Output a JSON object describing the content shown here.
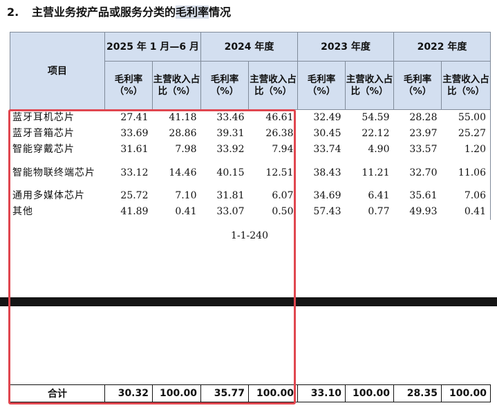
{
  "heading": {
    "number": "2.",
    "title_plain": "主营业务按产品或服务分类的",
    "title_highlight": "毛利率",
    "title_tail": "情况"
  },
  "table": {
    "item_header": "项目",
    "periods": [
      "2025 年 1 月—6 月",
      "2024 年度",
      "2023 年度",
      "2022 年度"
    ],
    "sub_headers": {
      "gross_margin": "毛利率（%）",
      "revenue_share": "主营收入占比（%）"
    },
    "rows": [
      {
        "name": "蓝牙耳机芯片",
        "values": [
          "27.41",
          "41.18",
          "33.46",
          "46.61",
          "32.49",
          "54.59",
          "28.28",
          "55.00"
        ]
      },
      {
        "name": "蓝牙音箱芯片",
        "values": [
          "33.69",
          "28.86",
          "39.31",
          "26.38",
          "30.45",
          "22.12",
          "23.97",
          "25.27"
        ]
      },
      {
        "name": "智能穿戴芯片",
        "values": [
          "31.61",
          "7.98",
          "33.92",
          "7.94",
          "33.74",
          "4.90",
          "33.57",
          "1.20"
        ]
      },
      {
        "name": "智能物联终端芯片",
        "values": [
          "33.12",
          "14.46",
          "40.15",
          "12.51",
          "38.43",
          "11.21",
          "32.70",
          "11.06"
        ]
      },
      {
        "name": "通用多媒体芯片",
        "values": [
          "25.72",
          "7.10",
          "31.81",
          "6.07",
          "34.69",
          "6.41",
          "35.61",
          "7.06"
        ]
      },
      {
        "name": "其他",
        "values": [
          "41.89",
          "0.41",
          "33.07",
          "0.50",
          "57.43",
          "0.77",
          "49.93",
          "0.41"
        ]
      }
    ],
    "total": {
      "name": "合计",
      "values": [
        "30.32",
        "100.00",
        "35.77",
        "100.00",
        "33.10",
        "100.00",
        "28.35",
        "100.00"
      ]
    }
  },
  "page_number": "1-1-240",
  "colors": {
    "header_bg": "#d3dff0",
    "annotation_red": "#e0464f",
    "band": "#151515"
  }
}
